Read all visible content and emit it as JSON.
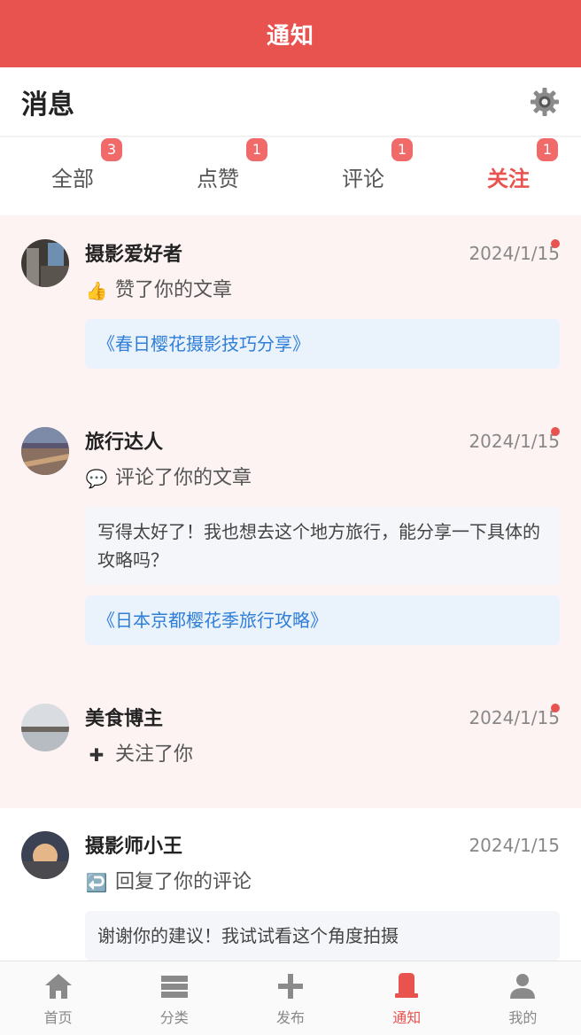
{
  "topbar": {
    "title": "通知"
  },
  "header": {
    "title": "消息",
    "settings_icon": "gear-icon"
  },
  "tabs": [
    {
      "label": "全部",
      "badge": "3",
      "active": false
    },
    {
      "label": "点赞",
      "badge": "1",
      "active": false
    },
    {
      "label": "评论",
      "badge": "1",
      "active": false
    },
    {
      "label": "关注",
      "badge": "1",
      "active": true
    }
  ],
  "notifications": [
    {
      "user": "摄影爱好者",
      "date": "2024/1/15",
      "icon": "👍",
      "action": "赞了你的文章",
      "article": "《春日樱花摄影技巧分享》",
      "unread": true
    },
    {
      "user": "旅行达人",
      "date": "2024/1/15",
      "icon": "💬",
      "action": "评论了你的文章",
      "comment": "写得太好了！我也想去这个地方旅行，能分享一下具体的攻略吗？",
      "article": "《日本京都樱花季旅行攻略》",
      "unread": true
    },
    {
      "user": "美食博主",
      "date": "2024/1/15",
      "icon": "✚",
      "action": "关注了你",
      "unread": true
    },
    {
      "user": "摄影师小王",
      "date": "2024/1/15",
      "icon": "↩️",
      "action": "回复了你的评论",
      "comment": "谢谢你的建议！我试试看这个角度拍摄",
      "unread": false
    }
  ],
  "bottom_nav": [
    {
      "label": "首页",
      "icon": "home-icon",
      "active": false
    },
    {
      "label": "分类",
      "icon": "category-icon",
      "active": false
    },
    {
      "label": "发布",
      "icon": "plus-icon",
      "active": false
    },
    {
      "label": "通知",
      "icon": "bell-icon",
      "active": true
    },
    {
      "label": "我的",
      "icon": "user-icon",
      "active": false
    }
  ],
  "colors": {
    "accent": "#e8524f",
    "link": "#2f7ed8",
    "unread_bg": "#fdf3f3"
  }
}
